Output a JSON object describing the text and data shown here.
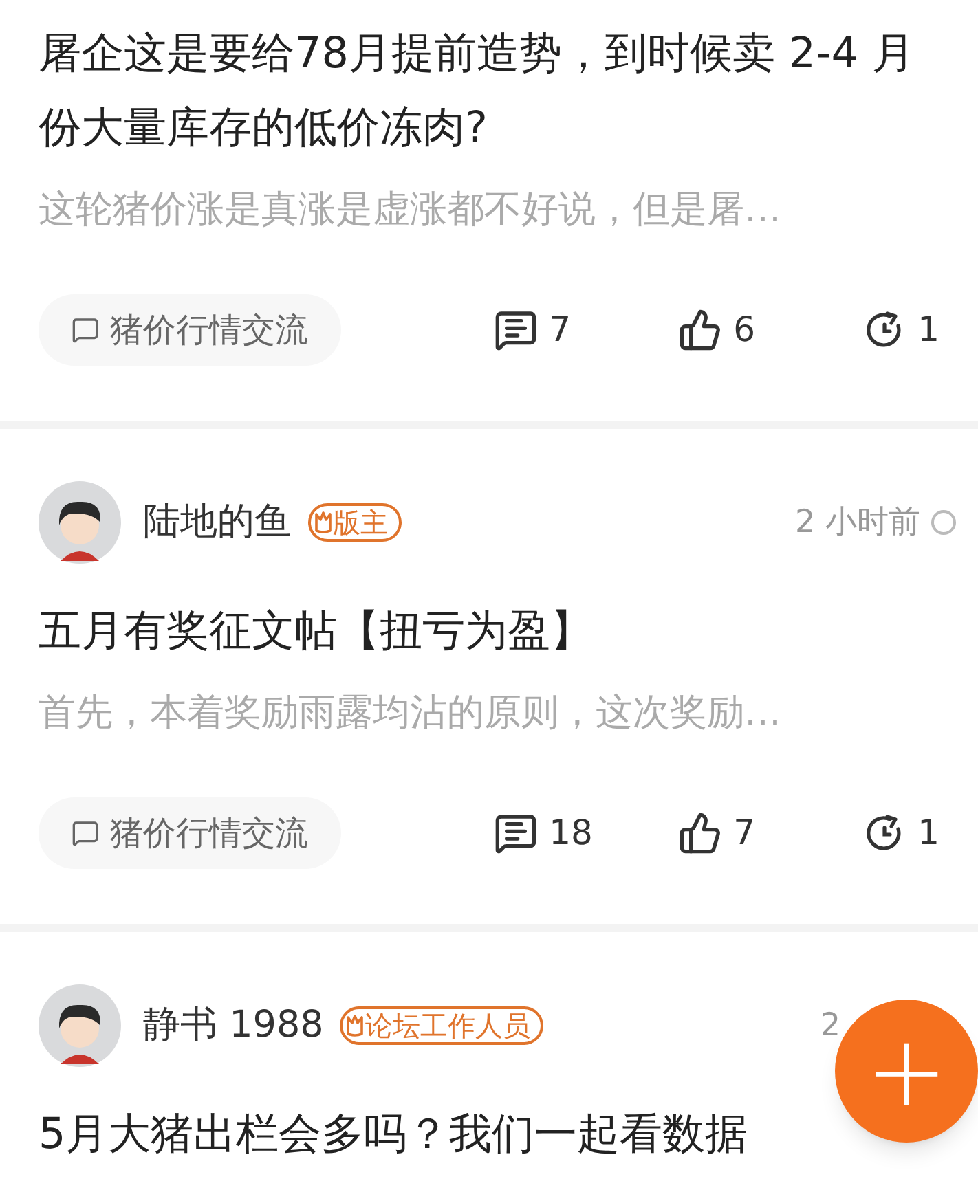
{
  "posts": [
    {
      "title": "屠企这是要给78月提前造势，到时候卖 2-4 月份大量库存的低价冻肉?",
      "excerpt": "这轮猪价涨是真涨是虚涨都不好说，但是屠…",
      "tag": "猪价行情交流",
      "comments": "7",
      "likes": "6",
      "shares": "1"
    },
    {
      "author": {
        "name": "陆地的鱼",
        "badge": "版主",
        "time": "2 小时前"
      },
      "title": "五月有奖征文帖【扭亏为盈】",
      "excerpt": "首先，本着奖励雨露均沾的原则，这次奖励…",
      "tag": "猪价行情交流",
      "comments": "18",
      "likes": "7",
      "shares": "1"
    },
    {
      "author": {
        "name": "静书 1988",
        "badge": "论坛工作人员",
        "time": "2"
      },
      "title": "5月大猪出栏会多吗？我们一起看数据"
    }
  ],
  "fab": {
    "label": "+"
  }
}
